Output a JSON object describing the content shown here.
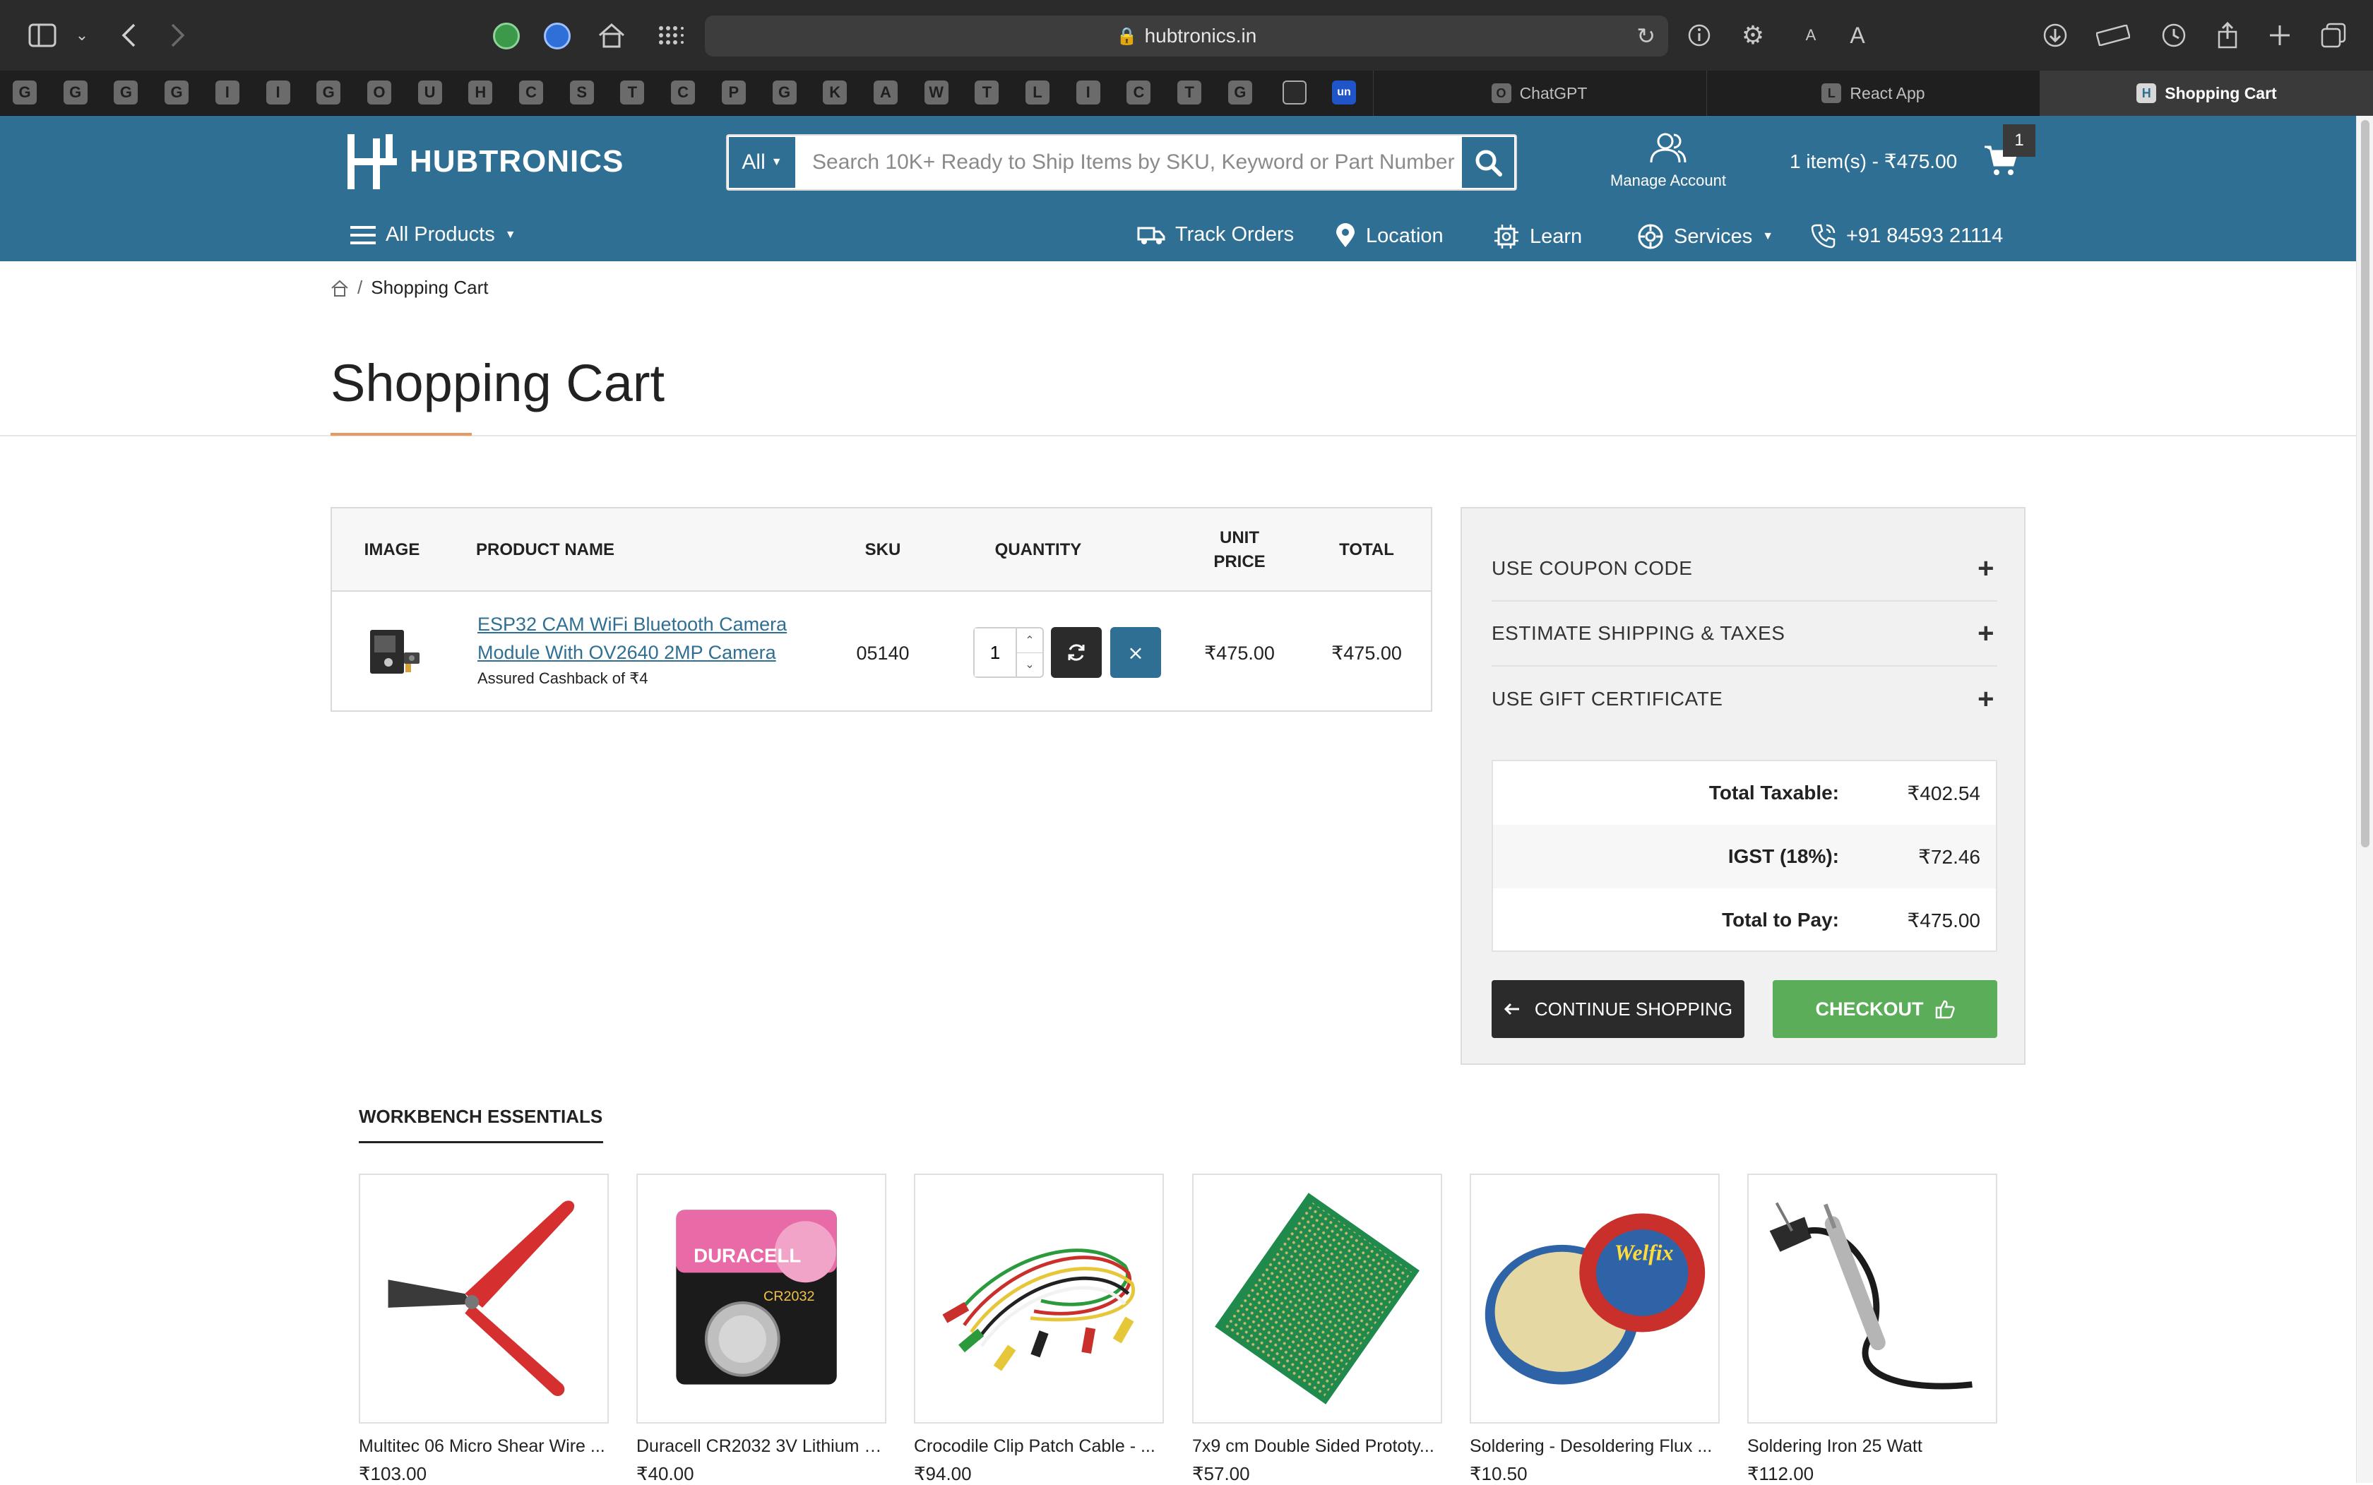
{
  "browser": {
    "url": "hubtronics.in",
    "text_size_small": "A",
    "text_size_large": "A",
    "pinned_tabs": [
      "G",
      "G",
      "G",
      "G",
      "I",
      "I",
      "G",
      "O",
      "U",
      "H",
      "C",
      "S",
      "T",
      "C",
      "P",
      "G",
      "K",
      "A",
      "W",
      "T",
      "L",
      "I",
      "C",
      "T",
      "G"
    ],
    "tabs": [
      {
        "label": "ChatGPT",
        "icon": "O"
      },
      {
        "label": "React App",
        "icon": "L"
      },
      {
        "label": "Shopping Cart",
        "icon": "H"
      }
    ]
  },
  "header": {
    "brand": "HUBTRONICS",
    "search": {
      "category": "All",
      "placeholder": "Search 10K+ Ready to Ship Items by SKU, Keyword or Part Number"
    },
    "account_label": "Manage Account",
    "cart_summary": "1 item(s) - ₹475.00",
    "cart_count": "1",
    "nav": {
      "all_products": "All Products",
      "track_orders": "Track Orders",
      "location": "Location",
      "learn": "Learn",
      "services": "Services",
      "phone": "+91 84593 21114"
    }
  },
  "breadcrumb": {
    "current": "Shopping Cart"
  },
  "page_title": "Shopping Cart",
  "cart": {
    "columns": {
      "image": "IMAGE",
      "product_name": "PRODUCT NAME",
      "sku": "SKU",
      "quantity": "QUANTITY",
      "unit_price_1": "UNIT",
      "unit_price_2": "PRICE",
      "total": "TOTAL"
    },
    "items": [
      {
        "name_line1": "ESP32 CAM WiFi Bluetooth Camera",
        "name_line2": "Module With OV2640 2MP Camera",
        "cashback": "Assured Cashback of ₹4",
        "sku": "05140",
        "quantity": "1",
        "unit_price": "₹475.00",
        "total": "₹475.00"
      }
    ]
  },
  "summary": {
    "coupon": "USE COUPON CODE",
    "shipping": "ESTIMATE SHIPPING & TAXES",
    "gift": "USE GIFT CERTIFICATE",
    "rows": [
      {
        "label": "Total Taxable:",
        "value": "₹402.54"
      },
      {
        "label": "IGST (18%):",
        "value": "₹72.46"
      },
      {
        "label": "Total to Pay:",
        "value": "₹475.00"
      }
    ],
    "continue_label": "CONTINUE SHOPPING",
    "checkout_label": "CHECKOUT"
  },
  "workbench": {
    "title": "WORKBENCH ESSENTIALS",
    "products": [
      {
        "name": "Multitec 06 Micro Shear Wire ...",
        "price": "₹103.00",
        "icon": "wire-cutter"
      },
      {
        "name": "Duracell CR2032 3V Lithium C...",
        "price": "₹40.00",
        "icon": "coin-battery"
      },
      {
        "name": "Crocodile Clip Patch Cable - ...",
        "price": "₹94.00",
        "icon": "crocodile-clips"
      },
      {
        "name": "7x9 cm Double Sided Prototy...",
        "price": "₹57.00",
        "icon": "pcb-board"
      },
      {
        "name": "Soldering - Desoldering Flux ...",
        "price": "₹10.50",
        "icon": "flux-tin"
      },
      {
        "name": "Soldering Iron 25 Watt",
        "price": "₹112.00",
        "icon": "soldering-iron"
      }
    ],
    "battery_label": "DURACELL",
    "battery_model": "CR2032",
    "flux_brand": "Welfix"
  },
  "colors": {
    "brand_blue": "#2f6f93",
    "checkout_green": "#5cad5a",
    "dark_button": "#2b2b2b",
    "title_accent": "#e39b63"
  }
}
